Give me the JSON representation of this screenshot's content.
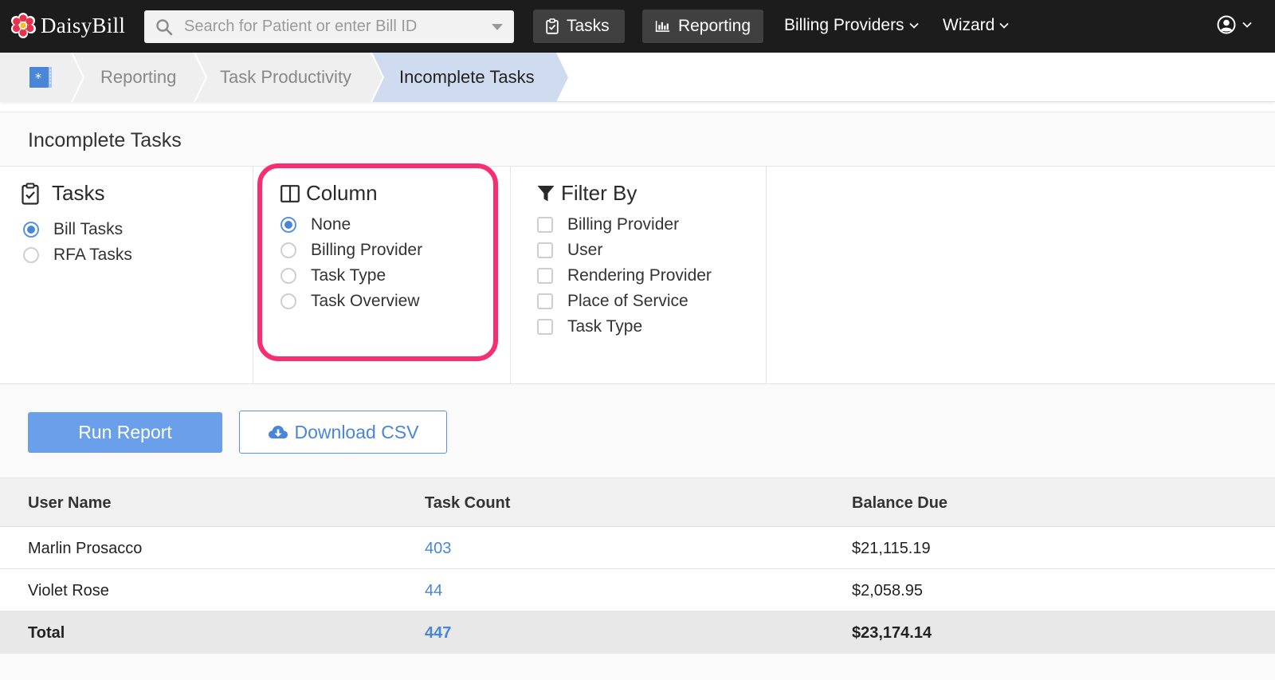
{
  "app": {
    "name": "DaisyBill"
  },
  "search": {
    "placeholder": "Search for Patient or enter Bill ID"
  },
  "nav": {
    "tasks": "Tasks",
    "reporting": "Reporting",
    "billing_providers": "Billing Providers",
    "wizard": "Wizard"
  },
  "breadcrumb": [
    "Reporting",
    "Task Productivity",
    "Incomplete Tasks"
  ],
  "page": {
    "title": "Incomplete Tasks"
  },
  "tasks_group": {
    "title": "Tasks",
    "options": [
      {
        "label": "Bill Tasks",
        "selected": true
      },
      {
        "label": "RFA Tasks",
        "selected": false
      }
    ]
  },
  "column_group": {
    "title": "Column",
    "options": [
      {
        "label": "None",
        "selected": true
      },
      {
        "label": "Billing Provider",
        "selected": false
      },
      {
        "label": "Task Type",
        "selected": false
      },
      {
        "label": "Task Overview",
        "selected": false
      }
    ]
  },
  "filter_group": {
    "title": "Filter By",
    "options": [
      {
        "label": "Billing Provider",
        "checked": false
      },
      {
        "label": "User",
        "checked": false
      },
      {
        "label": "Rendering Provider",
        "checked": false
      },
      {
        "label": "Place of Service",
        "checked": false
      },
      {
        "label": "Task Type",
        "checked": false
      }
    ]
  },
  "actions": {
    "run_report": "Run Report",
    "download_csv": "Download CSV"
  },
  "table": {
    "headers": [
      "User Name",
      "Task Count",
      "Balance Due"
    ],
    "rows": [
      {
        "user": "Marlin Prosacco",
        "count": "403",
        "balance": "$21,115.19"
      },
      {
        "user": "Violet Rose",
        "count": "44",
        "balance": "$2,058.95"
      }
    ],
    "total": {
      "label": "Total",
      "count": "447",
      "balance": "$23,174.14"
    }
  },
  "colors": {
    "accent": "#4a86d8",
    "highlight": "#f72f72",
    "nav_bg": "#1c1c1c"
  }
}
